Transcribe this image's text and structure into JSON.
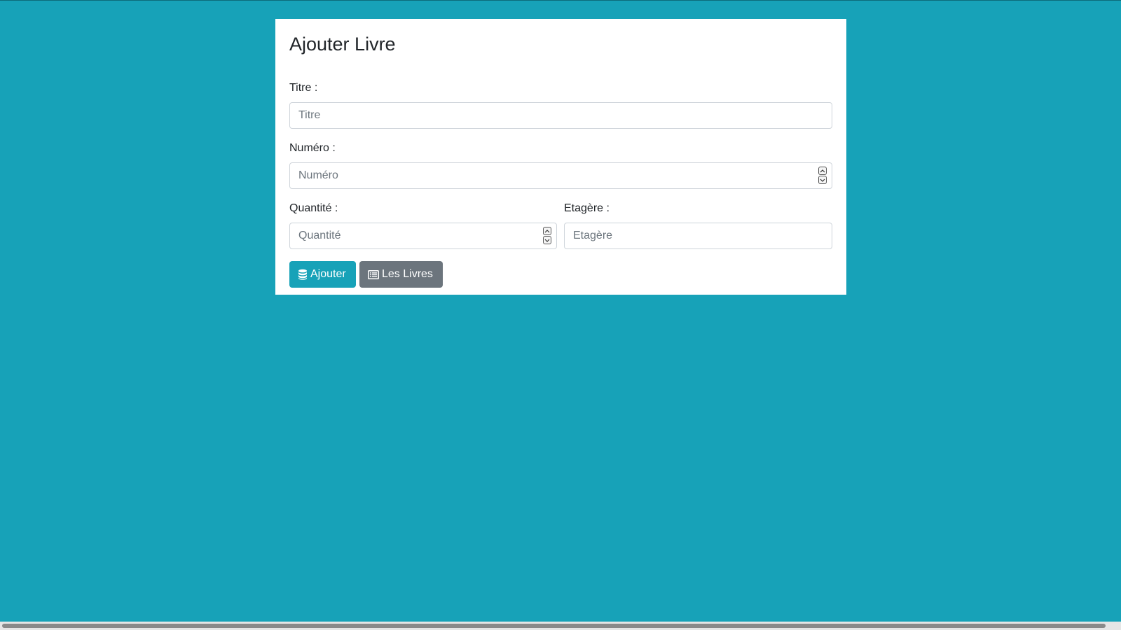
{
  "form": {
    "title": "Ajouter Livre",
    "fields": {
      "titre": {
        "label": "Titre :",
        "placeholder": "Titre",
        "value": ""
      },
      "numero": {
        "label": "Numéro :",
        "placeholder": "Numéro",
        "value": ""
      },
      "quantite": {
        "label": "Quantité :",
        "placeholder": "Quantité",
        "value": ""
      },
      "etagere": {
        "label": "Etagère :",
        "placeholder": "Etagère",
        "value": ""
      }
    },
    "buttons": {
      "add": {
        "label": "Ajouter",
        "icon": "database-icon"
      },
      "list": {
        "label": "Les Livres",
        "icon": "list-alt-icon"
      }
    }
  },
  "colors": {
    "background": "#17a2b8",
    "primary": "#17a2b8",
    "secondary": "#6c757d",
    "card": "#ffffff"
  }
}
